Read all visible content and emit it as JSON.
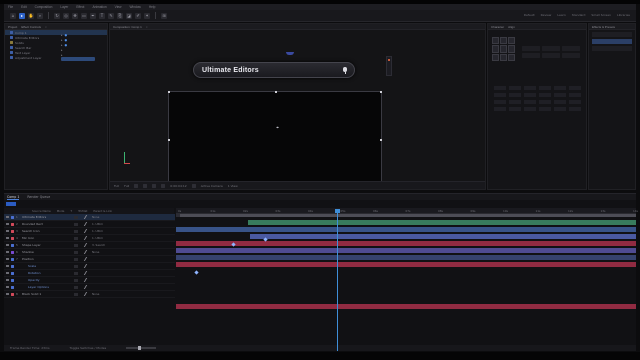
{
  "app": {
    "menu": [
      "File",
      "Edit",
      "Composition",
      "Layer",
      "Effect",
      "Animation",
      "View",
      "Window",
      "Help"
    ],
    "workspaces": [
      "Default",
      "Review",
      "Learn",
      "Standard",
      "Small Screen",
      "Libraries"
    ]
  },
  "project_panel": {
    "header": "Project",
    "effect_controls_header": "Effect Controls",
    "items": [
      "Comp 1",
      "Ultimate Editors",
      "Solids",
      "Search Bar",
      "Text Layer",
      "Adjustment Layer"
    ]
  },
  "composition": {
    "tab_label": "Composition: Comp 1",
    "search_bar_text": "Ultimate Editors",
    "viewer_zoom": "Full",
    "viewer_res": "Full",
    "viewer_timecode": "0:00:04:12",
    "viewer_camera": "Active Camera",
    "viewer_views": "1 View"
  },
  "character_panel": {
    "header": "Character",
    "align_header": "Align"
  },
  "right_panel": {
    "header": "Effects & Presets"
  },
  "timeline": {
    "tabs": [
      "Comp 1",
      "Render Queue"
    ],
    "active_tab": "Comp 1",
    "columns": [
      "Source Name",
      "Mode",
      "T",
      "TrkMat",
      "Parent & Link"
    ],
    "ruler_labels": [
      "0s",
      "01s",
      "02s",
      "03s",
      "04s",
      "05s",
      "06s",
      "07s",
      "08s",
      "09s",
      "10s",
      "11s",
      "12s",
      "13s",
      "14s"
    ],
    "layers": [
      {
        "num": "1",
        "name": "Ultimate Editors",
        "parent": "None",
        "color": "#4a6fd1"
      },
      {
        "num": "2",
        "name": "Rounded Rect",
        "parent": "1. Ultim",
        "color": "#d24a5a"
      },
      {
        "num": "3",
        "name": "Search Icon",
        "parent": "1. Ultim",
        "color": "#d24a5a"
      },
      {
        "num": "4",
        "name": "Mic Icon",
        "parent": "1. Ultim",
        "color": "#d24a5a"
      },
      {
        "num": "5",
        "name": "Shape Layer",
        "parent": "3. Search",
        "color": "#4a6fd1"
      },
      {
        "num": "6",
        "name": "Shadow",
        "parent": "None",
        "color": "#7a4ad1"
      },
      {
        "num": "7",
        "name": "Position",
        "parent": "",
        "color": "#4a6fd1"
      },
      {
        "num": "",
        "name": "Scale",
        "parent": "",
        "color": "#4a6fd1"
      },
      {
        "num": "",
        "name": "Rotation",
        "parent": "",
        "color": "#4a6fd1"
      },
      {
        "num": "",
        "name": "Opacity",
        "parent": "",
        "color": "#4a6fd1"
      },
      {
        "num": "",
        "name": "Layer Options",
        "parent": "",
        "color": "#4a6fd1"
      },
      {
        "num": "8",
        "name": "Black Solid 1",
        "parent": "None",
        "color": "#d24a5a"
      }
    ],
    "footer_left": "Frame Render Time: 23ms",
    "footer_right": "Toggle Switches / Modes"
  },
  "colors": {
    "accent": "#2d62c8",
    "playhead": "#3f8ed8",
    "track_blue": "#5566b8",
    "track_red": "#a8304a",
    "track_green": "#3f8f6a"
  }
}
